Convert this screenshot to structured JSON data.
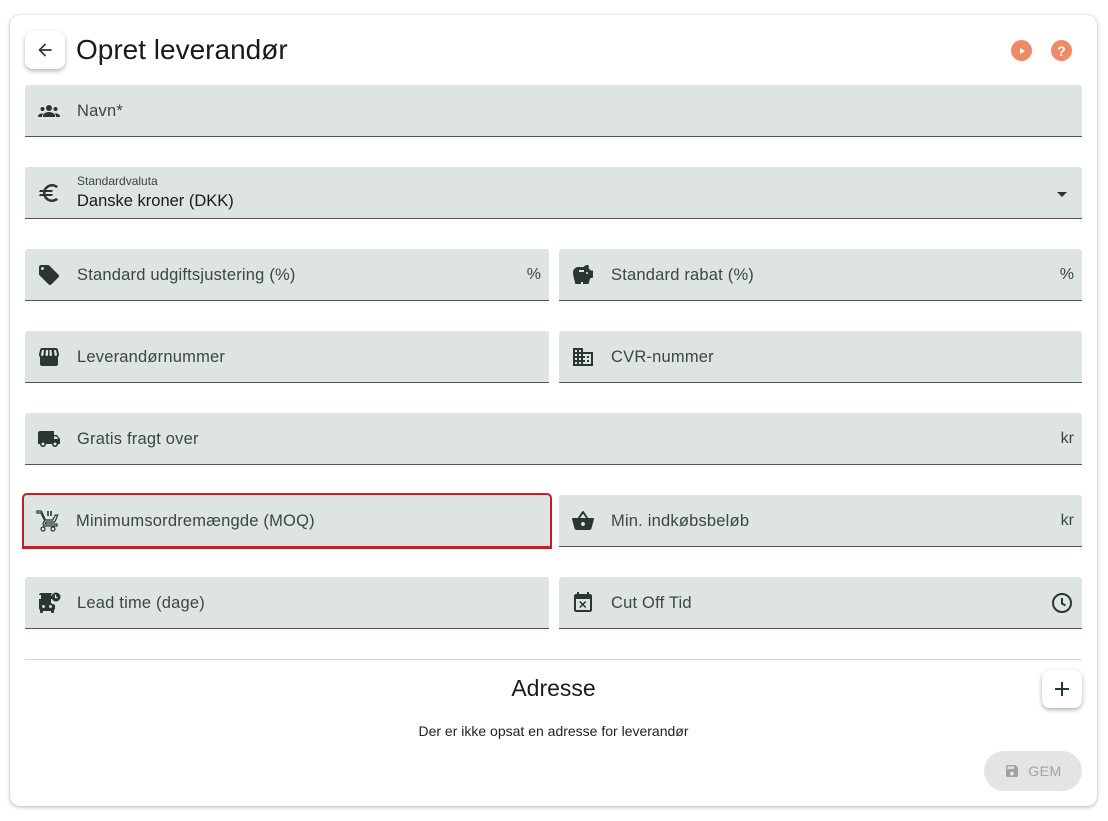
{
  "header": {
    "title": "Opret leverandør"
  },
  "fields": {
    "name": {
      "label": "Navn*"
    },
    "currency": {
      "label": "Standardvaluta",
      "value": "Danske kroner (DKK)"
    },
    "cost_adjustment": {
      "label": "Standard udgiftsjustering (%)",
      "suffix": "%"
    },
    "discount": {
      "label": "Standard rabat (%)",
      "suffix": "%"
    },
    "supplier_number": {
      "label": "Leverandørnummer"
    },
    "cvr": {
      "label": "CVR-nummer"
    },
    "free_shipping": {
      "label": "Gratis fragt over",
      "suffix": "kr"
    },
    "moq": {
      "label": "Minimumsordremængde (MOQ)"
    },
    "min_purchase": {
      "label": "Min. indkøbsbeløb",
      "suffix": "kr"
    },
    "lead_time": {
      "label": "Lead time (dage)"
    },
    "cut_off": {
      "label": "Cut Off Tid"
    }
  },
  "address": {
    "title": "Adresse",
    "empty_message": "Der er ikke opsat en adresse for leverandør"
  },
  "actions": {
    "save_label": "GEM"
  },
  "colors": {
    "accent": "#f08a66",
    "field_bg": "#dde4e2",
    "error": "#c0202a"
  }
}
